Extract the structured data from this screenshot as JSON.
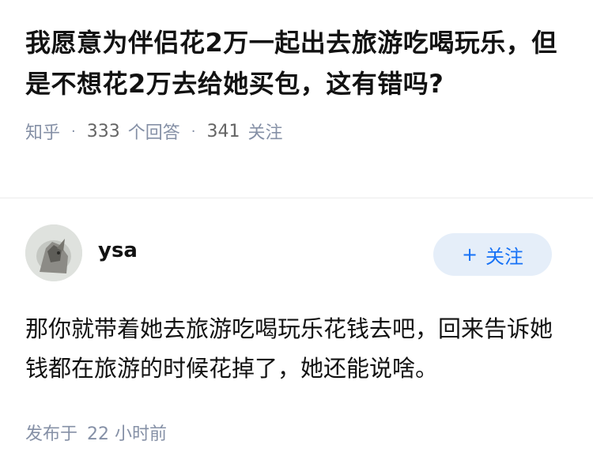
{
  "question": {
    "title": "我愿意为伴侣花2万一起出去旅游吃喝玩乐，但是不想花2万去给她买包，这有错吗?",
    "source": "知乎",
    "answers_count": "333",
    "answers_label": "个回答",
    "followers_count": "341",
    "followers_label": "关注"
  },
  "answer": {
    "author": "ysa",
    "follow_label": "关注",
    "follow_plus": "+",
    "content": "那你就带着她去旅游吃喝玩乐花钱去吧，回来告诉她钱都在旅游的时候花掉了，她还能说啥。",
    "publish_label": "发布于",
    "publish_time": "22 小时前"
  },
  "colors": {
    "accent": "#1772f6",
    "follow_bg": "#e5eef9",
    "meta_text": "#8590a6"
  }
}
